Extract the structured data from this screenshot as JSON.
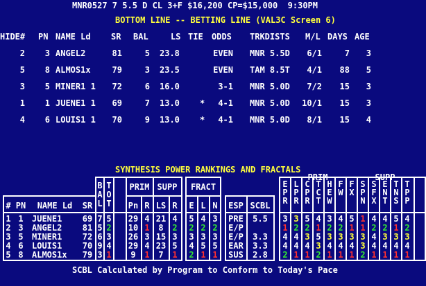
{
  "header": {
    "race_line": "MNR0527 7 5.5 D CL 3+F $16,200 CP=$15,000  9:30PM",
    "screen_title": "BOTTOM LINE -- BETTING LINE (VAL3C Screen 6)"
  },
  "betting_line": {
    "columns": [
      "HIDE#",
      "PN",
      "NAME Ld",
      "SR",
      "BAL",
      "LS",
      "TIE",
      "ODDS",
      "TRKDISTS",
      "M/L",
      "DAYS",
      "AGE"
    ],
    "rows": [
      {
        "hide": "2",
        "pn": "3",
        "name": "ANGEL2",
        "sr": "81",
        "bal": "5",
        "ls": "23.8",
        "tie": "",
        "odds": "EVEN",
        "trk": "MNR 5.5D",
        "ml": "6/1",
        "days": "7",
        "age": "3"
      },
      {
        "hide": "5",
        "pn": "8",
        "name": "ALMOS1x",
        "sr": "79",
        "bal": "3",
        "ls": "23.5",
        "tie": "",
        "odds": "EVEN",
        "trk": "TAM 8.5T",
        "ml": "4/1",
        "days": "88",
        "age": "5"
      },
      {
        "hide": "3",
        "pn": "5",
        "name": "MINER1 1",
        "sr": "72",
        "bal": "6",
        "ls": "16.0",
        "tie": "",
        "odds": "3-1",
        "trk": "MNR 5.0D",
        "ml": "7/2",
        "days": "15",
        "age": "3"
      },
      {
        "hide": "1",
        "pn": "1",
        "name": "JUENE1 1",
        "sr": "69",
        "bal": "7",
        "ls": "13.0",
        "tie": "*",
        "odds": "4-1",
        "trk": "MNR 5.0D",
        "ml": "10/1",
        "days": "15",
        "age": "3"
      },
      {
        "hide": "4",
        "pn": "6",
        "name": "LOUIS1 1",
        "sr": "70",
        "bal": "9",
        "ls": "13.0",
        "tie": "*",
        "odds": "4-1",
        "trk": "MNR 5.0D",
        "ml": "8/1",
        "days": "15",
        "age": "4"
      }
    ]
  },
  "synthesis": {
    "title": "SYNTHESIS POWER RANKINGS AND FRACTALS",
    "headers": {
      "num": "#",
      "pn": "PN",
      "name": "NAME Ld",
      "sr": "SR",
      "bal": "B\nA\nL",
      "tot": "T\nO\nT",
      "prim": "PRIM",
      "prim_pn": "Pn",
      "prim_r": "R",
      "supp": "SUPP",
      "supp_ls": "LS",
      "supp_r": "R",
      "fract": "FRACT",
      "fract_e": "E",
      "fract_l": "L",
      "fract_n": "N",
      "esp": "ESP",
      "scbl": "SCBL",
      "prim2": "PRIM",
      "supp2": "SUPP",
      "epr": "E\nP\nR",
      "lpr": "L\nP\nR",
      "cpr": "C\nP\nR",
      "ctt": "T\nC\nT",
      "hew": "H\nE\nW",
      "few": "F\nW",
      "fx": "F\nX",
      "spn": "S\nP\nN",
      "sfx": "S\nF\nX",
      "ent": "E\nN\nT",
      "tns": "T\nN\nS",
      "tpp": "T\nP\nP"
    },
    "rows": [
      {
        "num": "1",
        "pn": "1",
        "name": "JUENE1",
        "sr": "69",
        "bal": "7",
        "tot": "5",
        "prim_pn": "29",
        "prim_r": "4",
        "supp_ls": "21",
        "supp_r": "4",
        "fe": "5",
        "fl": "4",
        "fn": "3",
        "esp": "PRE",
        "scbl": "5.5"
      },
      {
        "num": "2",
        "pn": "3",
        "name": "ANGEL2",
        "sr": "81",
        "bal": "5",
        "tot": "2",
        "prim_pn": "10",
        "prim_r": "1",
        "supp_ls": "8",
        "supp_r": "2",
        "fe": "2",
        "fl": "2",
        "fn": "2",
        "esp": "E/P",
        "scbl": ""
      },
      {
        "num": "3",
        "pn": "5",
        "name": "MINER1",
        "sr": "72",
        "bal": "6",
        "tot": "3",
        "prim_pn": "26",
        "prim_r": "3",
        "supp_ls": "15",
        "supp_r": "3",
        "fe": "3",
        "fl": "3",
        "fn": "3",
        "esp": "E/P",
        "scbl": "3.3"
      },
      {
        "num": "4",
        "pn": "6",
        "name": "LOUIS1",
        "sr": "70",
        "bal": "9",
        "tot": "4",
        "prim_pn": "29",
        "prim_r": "4",
        "supp_ls": "23",
        "supp_r": "5",
        "fe": "4",
        "fl": "5",
        "fn": "5",
        "esp": "EAR",
        "scbl": "3.3"
      },
      {
        "num": "5",
        "pn": "8",
        "name": "ALMOS1x",
        "sr": "79",
        "bal": "3",
        "tot": "1",
        "prim_pn": "9",
        "prim_r": "1",
        "supp_ls": "7",
        "supp_r": "1",
        "fe": "2",
        "fl": "1",
        "fn": "1",
        "esp": "SUS",
        "scbl": "2.8"
      }
    ],
    "factor_rows": [
      [
        "3",
        "3",
        "5",
        "4",
        "3",
        "4",
        "5",
        "1",
        "4",
        "4",
        "5",
        "4"
      ],
      [
        "1",
        "2",
        "2",
        "1",
        "2",
        "2",
        "1",
        "1",
        "2",
        "2",
        "1",
        "2"
      ],
      [
        "4",
        "4",
        "3",
        "5",
        "3",
        "3",
        "3",
        "3",
        "4",
        "3",
        "3",
        "3"
      ],
      [
        "4",
        "4",
        "4",
        "3",
        "4",
        "4",
        "4",
        "3",
        "4",
        "4",
        "4",
        "4"
      ],
      [
        "2",
        "1",
        "1",
        "2",
        "1",
        "1",
        "1",
        "2",
        "1",
        "1",
        "1",
        "1"
      ]
    ],
    "factor_colors": [
      [
        "w",
        "y",
        "w",
        "w",
        "w",
        "w",
        "w",
        "r",
        "w",
        "w",
        "w",
        "w"
      ],
      [
        "r",
        "g",
        "g",
        "r",
        "g",
        "g",
        "r",
        "r",
        "g",
        "g",
        "r",
        "g"
      ],
      [
        "w",
        "w",
        "y",
        "w",
        "y",
        "y",
        "y",
        "y",
        "w",
        "y",
        "y",
        "y"
      ],
      [
        "w",
        "w",
        "w",
        "y",
        "w",
        "w",
        "w",
        "y",
        "w",
        "w",
        "w",
        "w"
      ],
      [
        "g",
        "r",
        "r",
        "g",
        "r",
        "r",
        "r",
        "g",
        "r",
        "r",
        "r",
        "r"
      ]
    ]
  },
  "footer": "SCBL Calculated by Program to Conform to Today's Pace",
  "colors": {
    "background": "#0a0a7e",
    "text": "#ffffff",
    "highlight": "#ffff3c",
    "first": "#ff3030",
    "second": "#33e633"
  }
}
